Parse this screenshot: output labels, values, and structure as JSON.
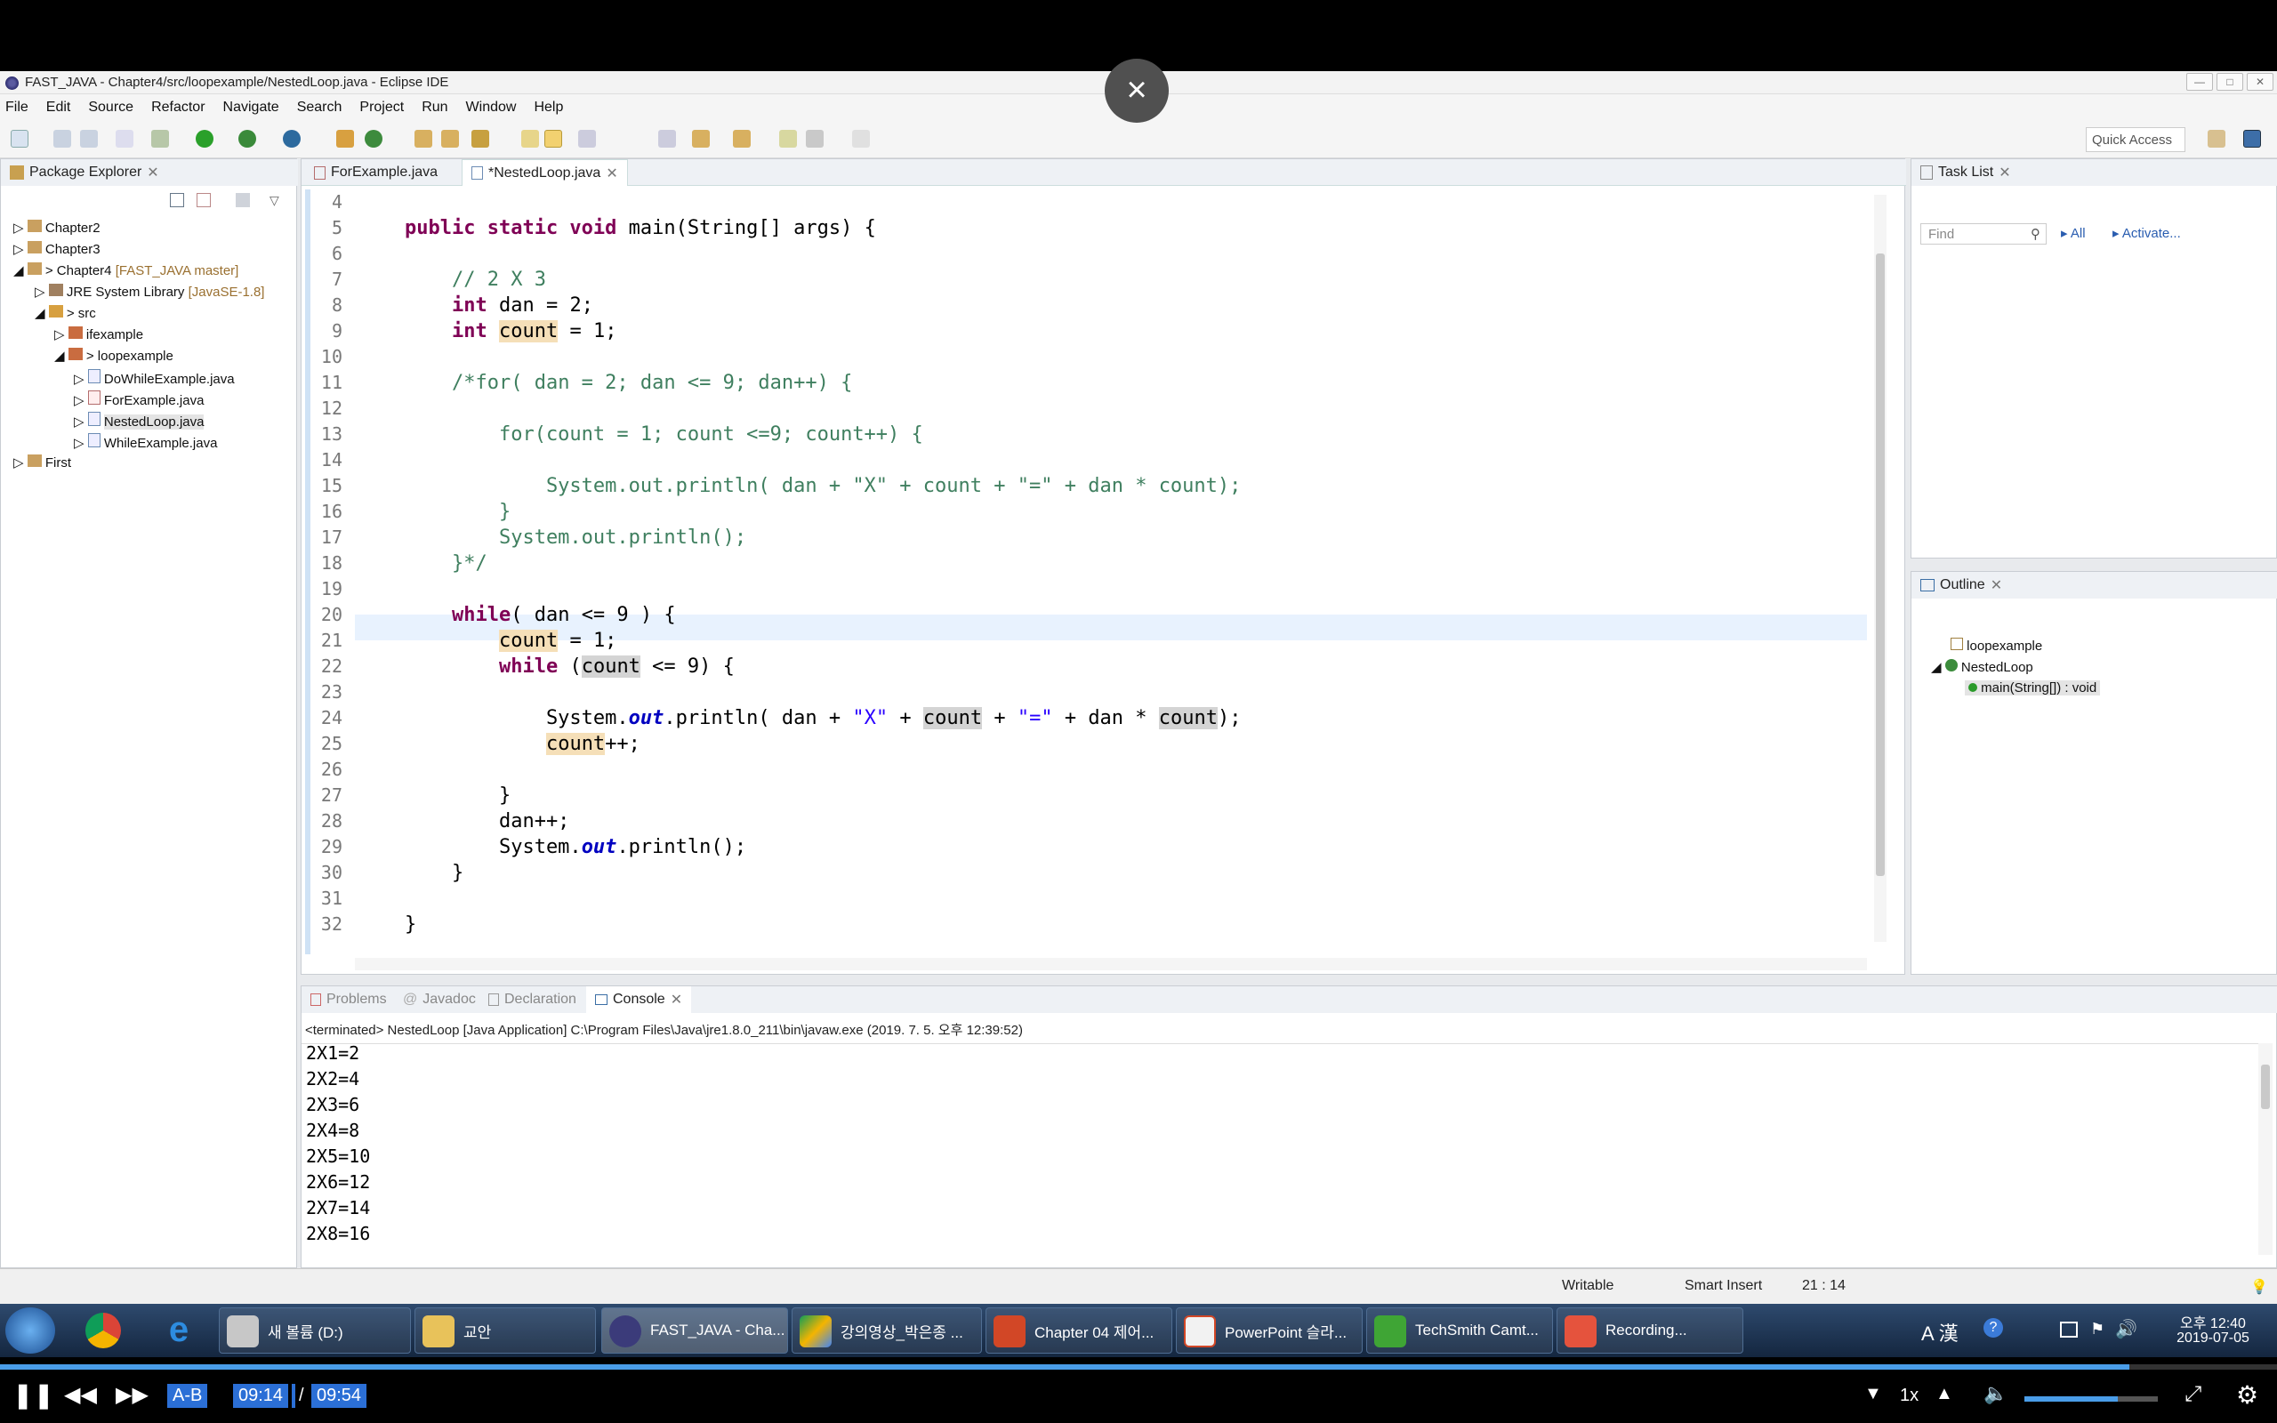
{
  "window": {
    "title": "FAST_JAVA - Chapter4/src/loopexample/NestedLoop.java - Eclipse IDE"
  },
  "menu": [
    "File",
    "Edit",
    "Source",
    "Refactor",
    "Navigate",
    "Search",
    "Project",
    "Run",
    "Window",
    "Help"
  ],
  "toolbar": {
    "quick_access": "Quick Access"
  },
  "package_explorer": {
    "title": "Package Explorer",
    "items": [
      {
        "label": "Chapter2"
      },
      {
        "label": "Chapter3"
      },
      {
        "label": "> Chapter4",
        "extra": "[FAST_JAVA master]"
      },
      {
        "label": "JRE System Library",
        "extra": "[JavaSE-1.8]"
      },
      {
        "label": "> src"
      },
      {
        "label": "ifexample"
      },
      {
        "label": "> loopexample"
      },
      {
        "label": "DoWhileExample.java"
      },
      {
        "label": "ForExample.java"
      },
      {
        "label": "NestedLoop.java"
      },
      {
        "label": "WhileExample.java"
      },
      {
        "label": "First"
      }
    ]
  },
  "editor": {
    "tabs": [
      "ForExample.java",
      "*NestedLoop.java"
    ],
    "line_numbers": [
      "4",
      "5",
      "6",
      "7",
      "8",
      "9",
      "10",
      "11",
      "12",
      "13",
      "14",
      "15",
      "16",
      "17",
      "18",
      "19",
      "20",
      "21",
      "22",
      "23",
      "24",
      "25",
      "26",
      "27",
      "28",
      "29",
      "30",
      "31",
      "32"
    ]
  },
  "task_list": {
    "title": "Task List",
    "find_placeholder": "Find",
    "all": "All",
    "activate": "Activate..."
  },
  "outline": {
    "title": "Outline",
    "items": [
      "loopexample",
      "NestedLoop",
      "main(String[]) : void"
    ]
  },
  "bottom_panel": {
    "tabs": [
      "Problems",
      "Javadoc",
      "Declaration",
      "Console"
    ],
    "console_header": "<terminated> NestedLoop [Java Application] C:\\Program Files\\Java\\jre1.8.0_211\\bin\\javaw.exe (2019. 7. 5. 오후 12:39:52)",
    "output": [
      "2X1=2",
      "2X2=4",
      "2X3=6",
      "2X4=8",
      "2X5=10",
      "2X6=12",
      "2X7=14",
      "2X8=16"
    ]
  },
  "statusbar": {
    "writable": "Writable",
    "insert_mode": "Smart Insert",
    "position": "21 : 14"
  },
  "taskbar": {
    "items": [
      "새 볼륨 (D:)",
      "교안",
      "FAST_JAVA - Cha...",
      "강의영상_박은종 ...",
      "Chapter 04 제어...",
      "PowerPoint 슬라...",
      "TechSmith Camt...",
      "Recording..."
    ],
    "clock_time": "오후 12:40",
    "clock_date": "2019-07-05",
    "tray": "A 漢"
  },
  "video": {
    "current_time": "09:14",
    "separator": "/",
    "total_time": "09:54",
    "ab_label": "A-B",
    "speed": "1x",
    "progress": 0.935,
    "volume": 0.7
  },
  "close_overlay": "×"
}
